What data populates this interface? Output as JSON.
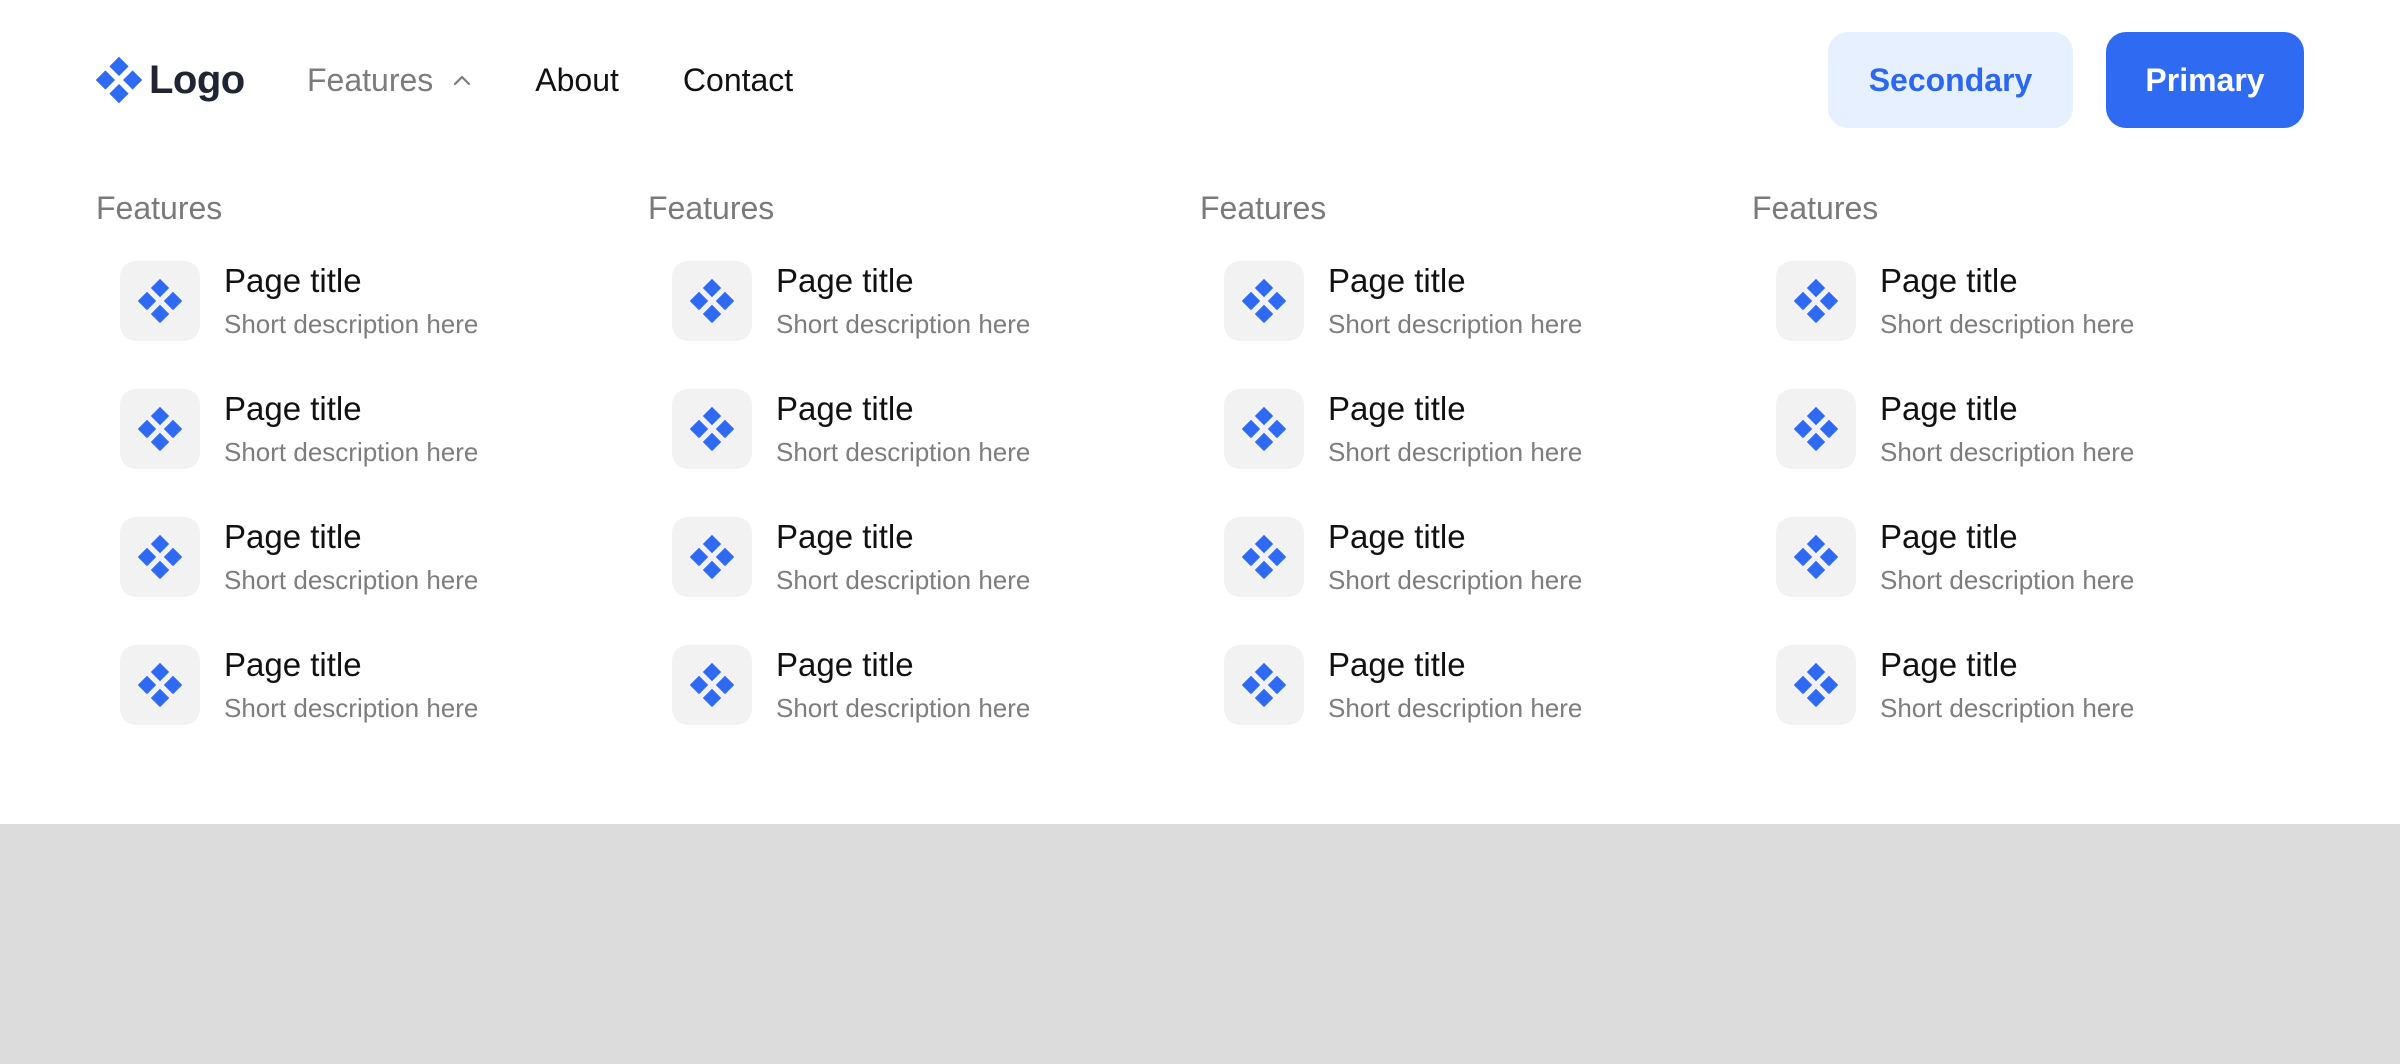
{
  "header": {
    "logo_text": "Logo",
    "logo_icon": "four-diamonds-icon",
    "nav": [
      {
        "label": "Features",
        "active": true,
        "icon": "chevron-up-icon"
      },
      {
        "label": "About"
      },
      {
        "label": "Contact"
      }
    ],
    "secondary_button": "Secondary",
    "primary_button": "Primary"
  },
  "colors": {
    "accent": "#2f6bf2",
    "secondary_bg": "#e6f0ff",
    "icon_tile_bg": "#f2f2f3",
    "overlay_bg": "#dcdcdc"
  },
  "menu": {
    "columns": [
      {
        "header": "Features",
        "items": [
          {
            "title": "Page title",
            "description": "Short description here",
            "icon": "four-diamonds-icon"
          },
          {
            "title": "Page title",
            "description": "Short description here",
            "icon": "four-diamonds-icon"
          },
          {
            "title": "Page title",
            "description": "Short description here",
            "icon": "four-diamonds-icon"
          },
          {
            "title": "Page title",
            "description": "Short description here",
            "icon": "four-diamonds-icon"
          }
        ]
      },
      {
        "header": "Features",
        "items": [
          {
            "title": "Page title",
            "description": "Short description here",
            "icon": "four-diamonds-icon"
          },
          {
            "title": "Page title",
            "description": "Short description here",
            "icon": "four-diamonds-icon"
          },
          {
            "title": "Page title",
            "description": "Short description here",
            "icon": "four-diamonds-icon"
          },
          {
            "title": "Page title",
            "description": "Short description here",
            "icon": "four-diamonds-icon"
          }
        ]
      },
      {
        "header": "Features",
        "items": [
          {
            "title": "Page title",
            "description": "Short description here",
            "icon": "four-diamonds-icon"
          },
          {
            "title": "Page title",
            "description": "Short description here",
            "icon": "four-diamonds-icon"
          },
          {
            "title": "Page title",
            "description": "Short description here",
            "icon": "four-diamonds-icon"
          },
          {
            "title": "Page title",
            "description": "Short description here",
            "icon": "four-diamonds-icon"
          }
        ]
      },
      {
        "header": "Features",
        "items": [
          {
            "title": "Page title",
            "description": "Short description here",
            "icon": "four-diamonds-icon"
          },
          {
            "title": "Page title",
            "description": "Short description here",
            "icon": "four-diamonds-icon"
          },
          {
            "title": "Page title",
            "description": "Short description here",
            "icon": "four-diamonds-icon"
          },
          {
            "title": "Page title",
            "description": "Short description here",
            "icon": "four-diamonds-icon"
          }
        ]
      }
    ]
  }
}
